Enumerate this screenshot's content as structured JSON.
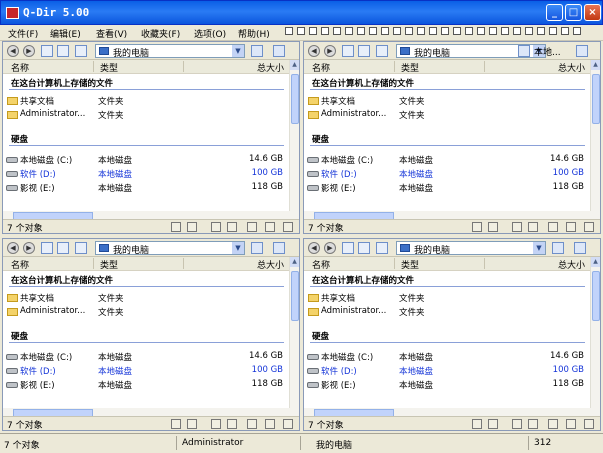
{
  "window": {
    "title": "Q-Dir 5.00"
  },
  "menu": [
    "文件(F)",
    "编辑(E)",
    "查看(V)",
    "收藏夹(F)",
    "选项(O)",
    "帮助(H)"
  ],
  "pane_common": {
    "location": "我的电脑",
    "col_name": "名称",
    "col_type": "类型",
    "col_size": "总大小",
    "section_files": "在这台计算机上存储的文件",
    "section_disks": "硬盘",
    "status_count": "7 个对象"
  },
  "right_address": "本地...",
  "files": [
    {
      "name": "共享文档",
      "type": "文件夹"
    },
    {
      "name": "Administrator...",
      "type": "文件夹"
    }
  ],
  "disks": [
    {
      "name": "本地磁盘 (C:)",
      "type": "本地磁盘",
      "size": "14.6 GB"
    },
    {
      "name": "软件 (D:)",
      "type": "本地磁盘",
      "size": "100 GB"
    },
    {
      "name": "影视 (E:)",
      "type": "本地磁盘",
      "size": "118 GB"
    }
  ],
  "statusbar": {
    "count": "7 个对象",
    "user": "Administrator",
    "location": "我的电脑",
    "number": "312"
  },
  "colors": {
    "titlebar": "#0A5FE6",
    "link_blue": "#1434D8",
    "chrome": "#ECE9D8"
  }
}
